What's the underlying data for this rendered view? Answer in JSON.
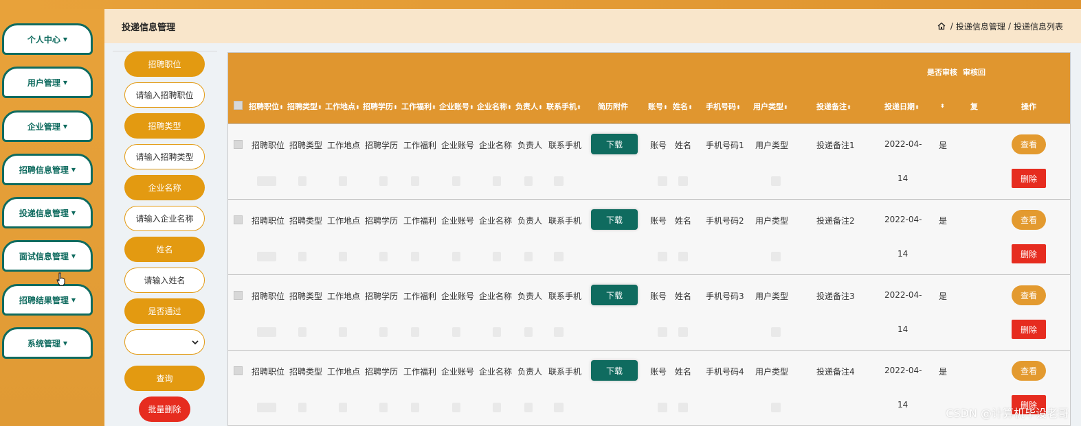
{
  "sidebar": {
    "items": [
      {
        "label": "个人中心"
      },
      {
        "label": "用户管理"
      },
      {
        "label": "企业管理"
      },
      {
        "label": "招聘信息管理"
      },
      {
        "label": "投递信息管理"
      },
      {
        "label": "面试信息管理"
      },
      {
        "label": "招聘结果管理"
      },
      {
        "label": "系统管理"
      }
    ],
    "caret": "▼"
  },
  "header": {
    "title": "投递信息管理",
    "breadcrumb": [
      "投递信息管理",
      "投递信息列表"
    ],
    "sep": "/"
  },
  "search": {
    "fields": [
      {
        "label": "招聘职位",
        "placeholder": "请输入招聘职位"
      },
      {
        "label": "招聘类型",
        "placeholder": "请输入招聘类型"
      },
      {
        "label": "企业名称",
        "placeholder": "请输入企业名称"
      },
      {
        "label": "姓名",
        "placeholder": "请输入姓名"
      }
    ],
    "select_label": "是否通过",
    "select_value": "",
    "query_label": "查询",
    "batch_delete_label": "批量删除"
  },
  "table": {
    "header_top": [
      "是否审核",
      "审核回"
    ],
    "columns": [
      "招聘职位",
      "招聘类型",
      "工作地点",
      "招聘学历",
      "工作福利",
      "企业账号",
      "企业名称",
      "负责人",
      "联系手机",
      "简历附件",
      "账号",
      "姓名",
      "手机号码",
      "用户类型",
      "投递备注",
      "投递日期",
      "",
      "复",
      "操作"
    ],
    "sort_icon": "⬍",
    "rows": [
      {
        "cells": [
          "招聘职位",
          "招聘类型",
          "工作地点",
          "招聘学历",
          "工作福利",
          "企业账号",
          "企业名称",
          "负责人",
          "联系手机"
        ],
        "download": "下载",
        "account": "账号",
        "name": "姓名",
        "phone": "手机号码1",
        "user_type": "用户类型",
        "remark": "投递备注1",
        "date1": "2022-04-",
        "date2": "14",
        "audit": "是",
        "view": "查看",
        "delete": "删除"
      },
      {
        "cells": [
          "招聘职位",
          "招聘类型",
          "工作地点",
          "招聘学历",
          "工作福利",
          "企业账号",
          "企业名称",
          "负责人",
          "联系手机"
        ],
        "download": "下载",
        "account": "账号",
        "name": "姓名",
        "phone": "手机号码2",
        "user_type": "用户类型",
        "remark": "投递备注2",
        "date1": "2022-04-",
        "date2": "14",
        "audit": "是",
        "view": "查看",
        "delete": "删除"
      },
      {
        "cells": [
          "招聘职位",
          "招聘类型",
          "工作地点",
          "招聘学历",
          "工作福利",
          "企业账号",
          "企业名称",
          "负责人",
          "联系手机"
        ],
        "download": "下载",
        "account": "账号",
        "name": "姓名",
        "phone": "手机号码3",
        "user_type": "用户类型",
        "remark": "投递备注3",
        "date1": "2022-04-",
        "date2": "14",
        "audit": "是",
        "view": "查看",
        "delete": "删除"
      },
      {
        "cells": [
          "招聘职位",
          "招聘类型",
          "工作地点",
          "招聘学历",
          "工作福利",
          "企业账号",
          "企业名称",
          "负责人",
          "联系手机"
        ],
        "download": "下载",
        "account": "账号",
        "name": "姓名",
        "phone": "手机号码4",
        "user_type": "用户类型",
        "remark": "投递备注4",
        "date1": "2022-04-",
        "date2": "14",
        "audit": "是",
        "view": "查看",
        "delete": "删除"
      }
    ]
  },
  "watermark": "CSDN @计算机毕设老哥",
  "colors": {
    "accent": "#e39a11",
    "teal": "#0f6b5f",
    "danger": "#e62c1f",
    "header_bg": "#e0962f"
  }
}
